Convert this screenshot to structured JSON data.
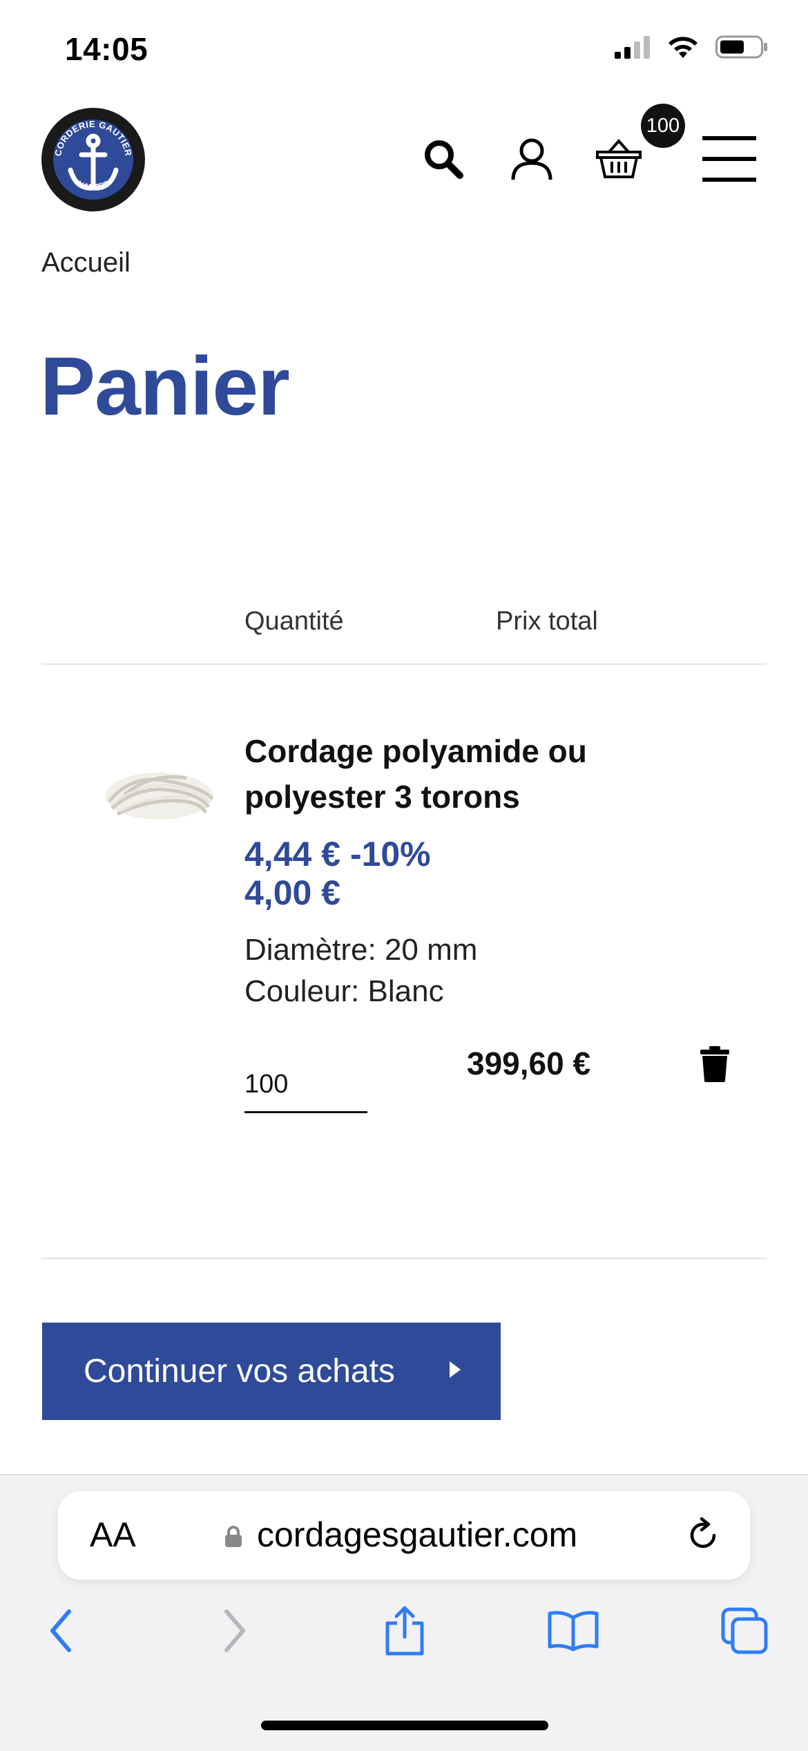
{
  "status_bar": {
    "time": "14:05",
    "icons": [
      "signal-icon",
      "wifi-icon",
      "battery-icon"
    ]
  },
  "header": {
    "logo_text": {
      "top": "CORDERIE GAUTIER",
      "bottom": "NANTES"
    },
    "icons": [
      "search-icon",
      "user-icon",
      "basket-icon",
      "menu-icon"
    ],
    "cart_count": "100"
  },
  "breadcrumb": "Accueil",
  "page_title": "Panier",
  "table_headers": {
    "quantity": "Quantité",
    "total": "Prix total"
  },
  "cart_item": {
    "title": "Cordage polyamide ou polyester 3 torons",
    "original_price_line": "4,44 € -10%",
    "price": "4,00 €",
    "options": [
      "Diamètre: 20 mm",
      "Couleur: Blanc"
    ],
    "quantity": "100",
    "line_total": "399,60 €"
  },
  "continue_button": "Continuer vos achats",
  "browser": {
    "aa_label": "AA",
    "url": "cordagesgautier.com",
    "toolbar": [
      "back-icon",
      "forward-icon",
      "share-icon",
      "bookmarks-icon",
      "tabs-icon"
    ]
  },
  "colors": {
    "brand": "#2e4a98",
    "text": "#111111",
    "divider": "#e3e3e3"
  }
}
